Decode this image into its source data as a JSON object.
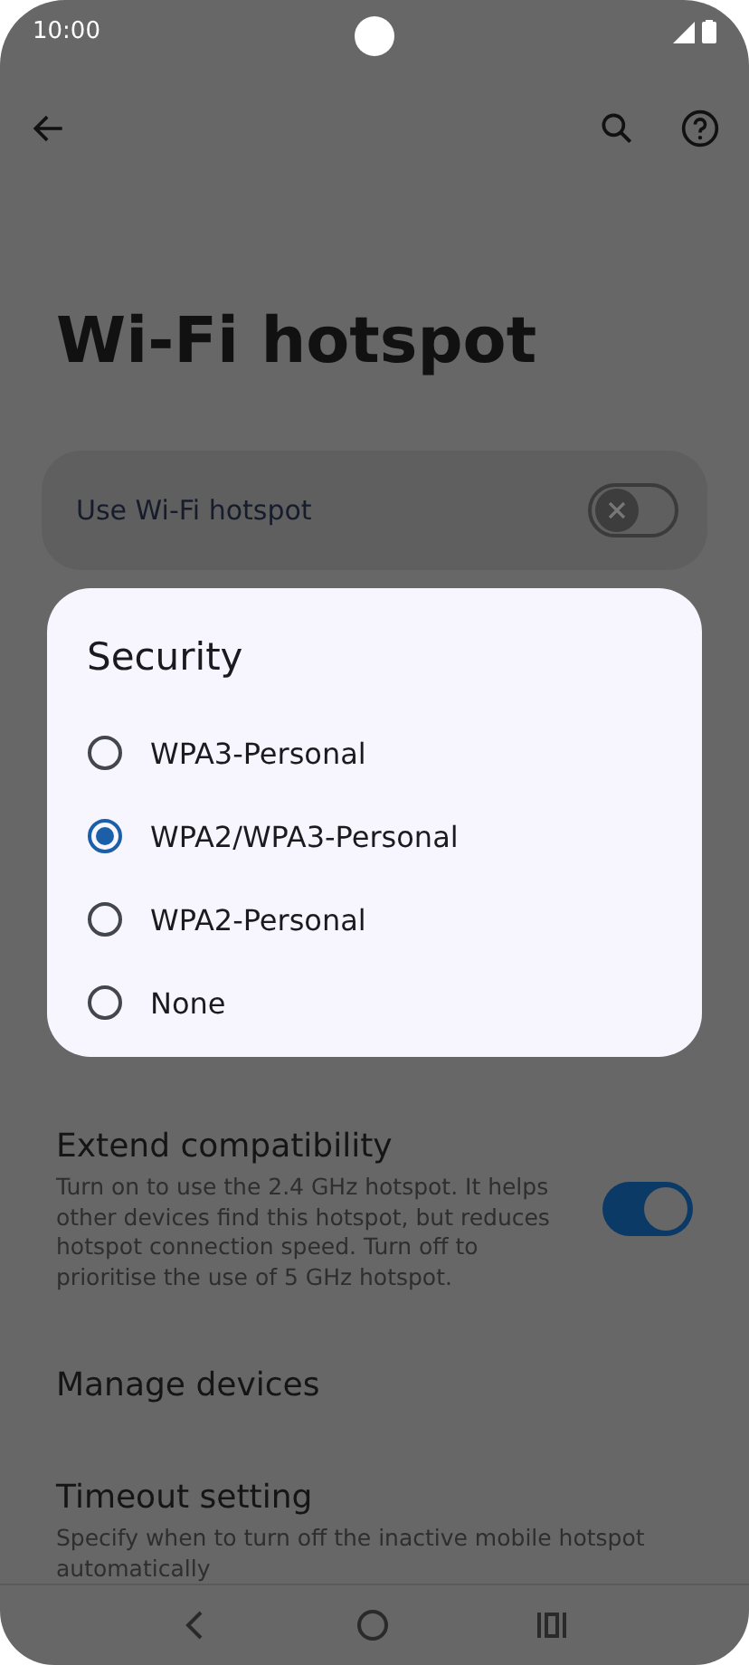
{
  "status_bar": {
    "time": "10:00"
  },
  "title": "Wi-Fi hotspot",
  "master_switch": {
    "label": "Use Wi-Fi hotspot",
    "on": false
  },
  "settings": [
    {
      "kind": "switch",
      "title": "Extend compatibility",
      "description": "Turn on to use the 2.4 GHz hotspot. It helps other devices find this hotspot, but reduces hotspot connection speed. Turn off to prioritise the use of 5 GHz hotspot.",
      "on": true
    },
    {
      "kind": "link",
      "title": "Manage devices"
    },
    {
      "kind": "link",
      "title": "Timeout setting",
      "description": "Specify when to turn off the inactive mobile hotspot automatically"
    }
  ],
  "dialog": {
    "title": "Security",
    "options": [
      {
        "label": "WPA3-Personal",
        "selected": false
      },
      {
        "label": "WPA2/WPA3-Personal",
        "selected": true
      },
      {
        "label": "WPA2-Personal",
        "selected": false
      },
      {
        "label": "None",
        "selected": false
      }
    ]
  }
}
